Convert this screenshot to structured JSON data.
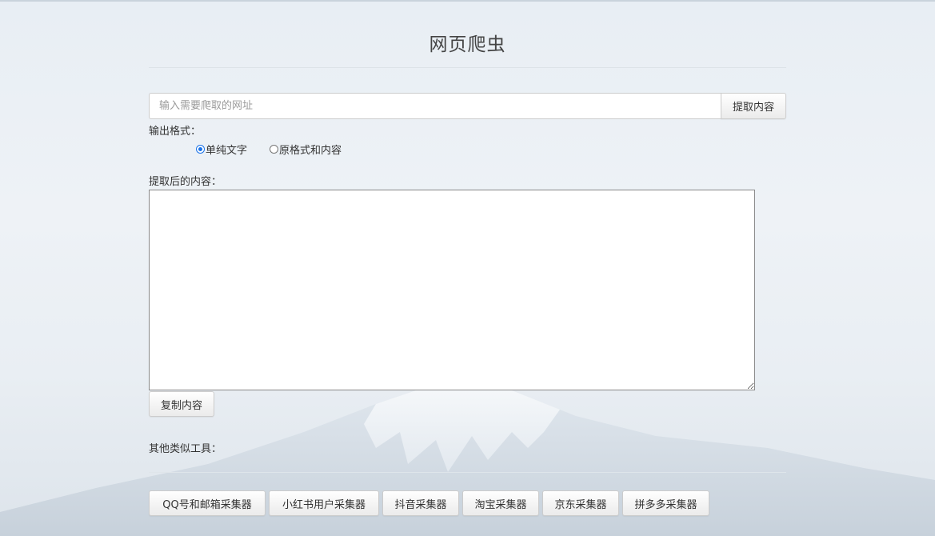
{
  "page": {
    "title": "网页爬虫"
  },
  "url_input": {
    "placeholder": "输入需要爬取的网址",
    "value": ""
  },
  "extract_button": {
    "label": "提取内容"
  },
  "output_format": {
    "label": "输出格式：",
    "options": [
      {
        "label": "单纯文字",
        "checked": true
      },
      {
        "label": "原格式和内容",
        "checked": false
      }
    ]
  },
  "result": {
    "label": "提取后的内容：",
    "value": ""
  },
  "copy_button": {
    "label": "复制内容"
  },
  "other_tools": {
    "label": "其他类似工具：",
    "items": [
      {
        "label": "QQ号和邮箱采集器"
      },
      {
        "label": "小红书用户采集器"
      },
      {
        "label": "抖音采集器"
      },
      {
        "label": "淘宝采集器"
      },
      {
        "label": "京东采集器"
      },
      {
        "label": "拼多多采集器"
      }
    ]
  },
  "colors": {
    "accent": "#1a73e8",
    "background": "#e8eef4"
  }
}
